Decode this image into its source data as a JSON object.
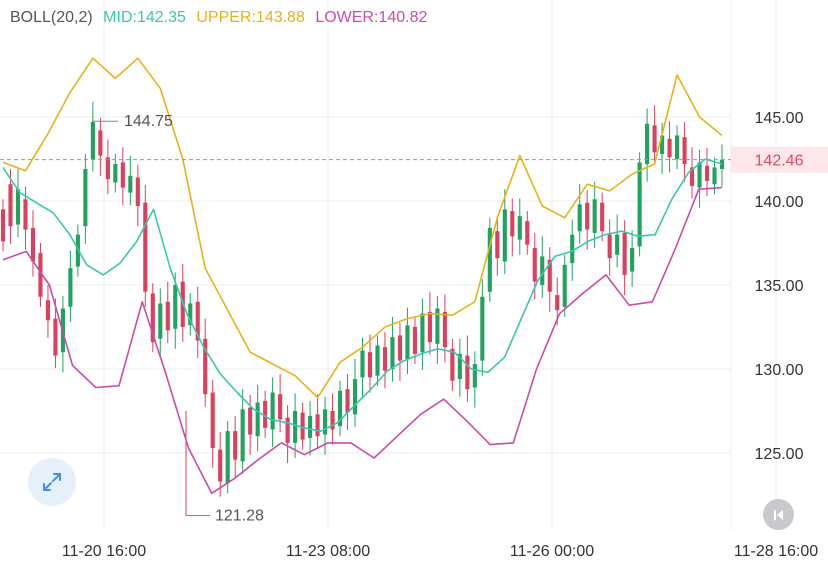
{
  "legend": {
    "name": "BOLL(20,2)",
    "mid": "MID:142.35",
    "upper": "UPPER:143.88",
    "lower": "LOWER:140.82"
  },
  "colors": {
    "mid": "#3cc7ad",
    "upper": "#e5b41c",
    "lower": "#c94da8",
    "up": "#21a35f",
    "down": "#dd3f5e",
    "last_price_bg": "#fde7ea",
    "last_price_text": "#e04a5d",
    "grid": "#ececec",
    "axis_text": "#333333"
  },
  "current_price": {
    "value": 142.46,
    "label": "142.46"
  },
  "annotations": {
    "high_label": "144.75",
    "low_label": "121.28"
  },
  "icons": {
    "expand": "expand-arrows-icon",
    "back": "skip-back-icon"
  },
  "chart_data": {
    "type": "candlestick",
    "title": "",
    "indicator": "BOLL(20,2)",
    "y_ticks": [
      {
        "value": 145,
        "label": "145.00"
      },
      {
        "value": 140,
        "label": "140.00"
      },
      {
        "value": 135,
        "label": "135.00"
      },
      {
        "value": 130,
        "label": "130.00"
      },
      {
        "value": 125,
        "label": "125.00"
      }
    ],
    "x_ticks": [
      "11-20 16:00",
      "11-23 08:00",
      "11-26 00:00",
      "11-28 16:00"
    ],
    "high": 144.75,
    "low": 121.28,
    "series": [
      {
        "name": "MID",
        "values": [
          142.0,
          140.5,
          139.9,
          139.3,
          138.0,
          136.2,
          135.6,
          136.3,
          137.6,
          139.5,
          136.0,
          133.3,
          131.3,
          129.7,
          128.6,
          127.6,
          127.0,
          126.8,
          126.5,
          126.3,
          126.8,
          127.8,
          128.8,
          129.9,
          130.5,
          130.9,
          131.2,
          131.0,
          130.0,
          129.8,
          130.7,
          133.0,
          135.3,
          136.7,
          137.0,
          137.6,
          138.0,
          138.2,
          137.9,
          138.0,
          140.1,
          141.7,
          142.5,
          142.2
        ]
      },
      {
        "name": "UPPER",
        "values": [
          142.3,
          141.8,
          144.0,
          146.5,
          148.5,
          147.3,
          148.5,
          146.7,
          142.5,
          136.0,
          133.5,
          131.0,
          130.3,
          129.6,
          128.3,
          130.4,
          131.3,
          132.5,
          133.0,
          133.3,
          133.2,
          134.0,
          139.0,
          142.7,
          139.7,
          139.0,
          141.0,
          140.6,
          141.6,
          142.2,
          147.5,
          145.0,
          143.9
        ]
      },
      {
        "name": "LOWER",
        "values": [
          136.5,
          137.0,
          135.0,
          130.2,
          128.9,
          129.0,
          134.0,
          129.8,
          125.3,
          122.6,
          123.5,
          124.6,
          125.6,
          124.9,
          125.6,
          125.6,
          124.7,
          126.0,
          127.3,
          128.2,
          126.9,
          125.5,
          125.6,
          130.0,
          133.3,
          134.5,
          135.6,
          133.8,
          134.0,
          137.2,
          140.7,
          140.8
        ]
      }
    ],
    "candles": [
      {
        "o": 139.5,
        "c": 137.6
      },
      {
        "o": 141.0,
        "c": 138.5
      },
      {
        "o": 138.6,
        "c": 140.7
      },
      {
        "o": 140.1,
        "c": 138.3
      },
      {
        "o": 138.4,
        "c": 136.4
      },
      {
        "o": 136.9,
        "c": 134.3
      },
      {
        "o": 134.1,
        "c": 132.9
      },
      {
        "o": 133.0,
        "c": 130.8
      },
      {
        "o": 131.0,
        "c": 133.6
      },
      {
        "o": 133.7,
        "c": 136.0
      },
      {
        "o": 136.1,
        "c": 138.0
      },
      {
        "o": 138.5,
        "c": 141.9
      },
      {
        "o": 142.5,
        "c": 144.7
      },
      {
        "o": 144.2,
        "c": 142.7
      },
      {
        "o": 142.6,
        "c": 141.3
      },
      {
        "o": 141.1,
        "c": 142.2
      },
      {
        "o": 142.3,
        "c": 140.8
      },
      {
        "o": 140.5,
        "c": 141.5
      },
      {
        "o": 141.4,
        "c": 139.7
      },
      {
        "o": 139.9,
        "c": 134.6
      },
      {
        "o": 134.5,
        "c": 131.6
      },
      {
        "o": 131.8,
        "c": 133.9
      },
      {
        "o": 134.0,
        "c": 132.3
      },
      {
        "o": 132.4,
        "c": 135.0
      },
      {
        "o": 135.2,
        "c": 132.5
      },
      {
        "o": 132.6,
        "c": 133.9
      },
      {
        "o": 134.0,
        "c": 131.7
      },
      {
        "o": 131.8,
        "c": 128.5
      },
      {
        "o": 128.6,
        "c": 125.3
      },
      {
        "o": 125.2,
        "c": 123.3
      },
      {
        "o": 123.2,
        "c": 126.3
      },
      {
        "o": 126.3,
        "c": 124.6
      },
      {
        "o": 124.5,
        "c": 127.6
      },
      {
        "o": 127.7,
        "c": 126.1
      },
      {
        "o": 126.0,
        "c": 128.0
      },
      {
        "o": 128.1,
        "c": 126.5
      },
      {
        "o": 126.4,
        "c": 128.6
      },
      {
        "o": 128.5,
        "c": 127.0
      },
      {
        "o": 127.1,
        "c": 125.6
      },
      {
        "o": 125.6,
        "c": 127.5
      },
      {
        "o": 127.4,
        "c": 125.8
      },
      {
        "o": 125.9,
        "c": 127.2
      },
      {
        "o": 127.3,
        "c": 126.0
      },
      {
        "o": 126.1,
        "c": 127.6
      },
      {
        "o": 127.5,
        "c": 126.4
      },
      {
        "o": 126.6,
        "c": 128.7
      },
      {
        "o": 128.8,
        "c": 127.4
      },
      {
        "o": 127.3,
        "c": 129.4
      },
      {
        "o": 129.5,
        "c": 131.1
      },
      {
        "o": 131.0,
        "c": 129.5
      },
      {
        "o": 129.6,
        "c": 131.4
      },
      {
        "o": 131.3,
        "c": 129.9
      },
      {
        "o": 130.0,
        "c": 131.9
      },
      {
        "o": 132.0,
        "c": 130.5
      },
      {
        "o": 130.6,
        "c": 132.6
      },
      {
        "o": 132.5,
        "c": 130.9
      },
      {
        "o": 131.0,
        "c": 133.3
      },
      {
        "o": 133.4,
        "c": 131.6
      },
      {
        "o": 131.5,
        "c": 133.6
      },
      {
        "o": 133.4,
        "c": 131.3
      },
      {
        "o": 131.2,
        "c": 129.3
      },
      {
        "o": 129.4,
        "c": 130.9
      },
      {
        "o": 130.8,
        "c": 128.8
      },
      {
        "o": 128.9,
        "c": 130.3
      },
      {
        "o": 130.5,
        "c": 134.3
      },
      {
        "o": 134.6,
        "c": 138.4
      },
      {
        "o": 138.2,
        "c": 136.6
      },
      {
        "o": 136.4,
        "c": 139.5
      },
      {
        "o": 139.4,
        "c": 137.9
      },
      {
        "o": 137.7,
        "c": 139.1
      },
      {
        "o": 138.8,
        "c": 137.4
      },
      {
        "o": 137.2,
        "c": 135.2
      },
      {
        "o": 135.0,
        "c": 136.7
      },
      {
        "o": 136.5,
        "c": 134.6
      },
      {
        "o": 134.4,
        "c": 133.5
      },
      {
        "o": 133.7,
        "c": 136.2
      },
      {
        "o": 136.3,
        "c": 138.0
      },
      {
        "o": 138.2,
        "c": 139.8
      },
      {
        "o": 139.9,
        "c": 138.3
      },
      {
        "o": 138.1,
        "c": 140.1
      },
      {
        "o": 139.9,
        "c": 138.2
      },
      {
        "o": 138.0,
        "c": 136.6
      },
      {
        "o": 136.8,
        "c": 138.0
      },
      {
        "o": 138.1,
        "c": 135.6
      },
      {
        "o": 135.8,
        "c": 137.2
      },
      {
        "o": 137.3,
        "c": 142.3
      },
      {
        "o": 142.2,
        "c": 144.6
      },
      {
        "o": 144.5,
        "c": 142.9
      },
      {
        "o": 142.8,
        "c": 143.9
      },
      {
        "o": 143.7,
        "c": 142.6
      },
      {
        "o": 142.5,
        "c": 143.9
      },
      {
        "o": 143.8,
        "c": 142.2
      },
      {
        "o": 142.0,
        "c": 140.9
      },
      {
        "o": 140.8,
        "c": 142.3
      },
      {
        "o": 142.1,
        "c": 141.2
      },
      {
        "o": 141.0,
        "c": 142.0
      },
      {
        "o": 141.9,
        "c": 142.46
      }
    ]
  }
}
